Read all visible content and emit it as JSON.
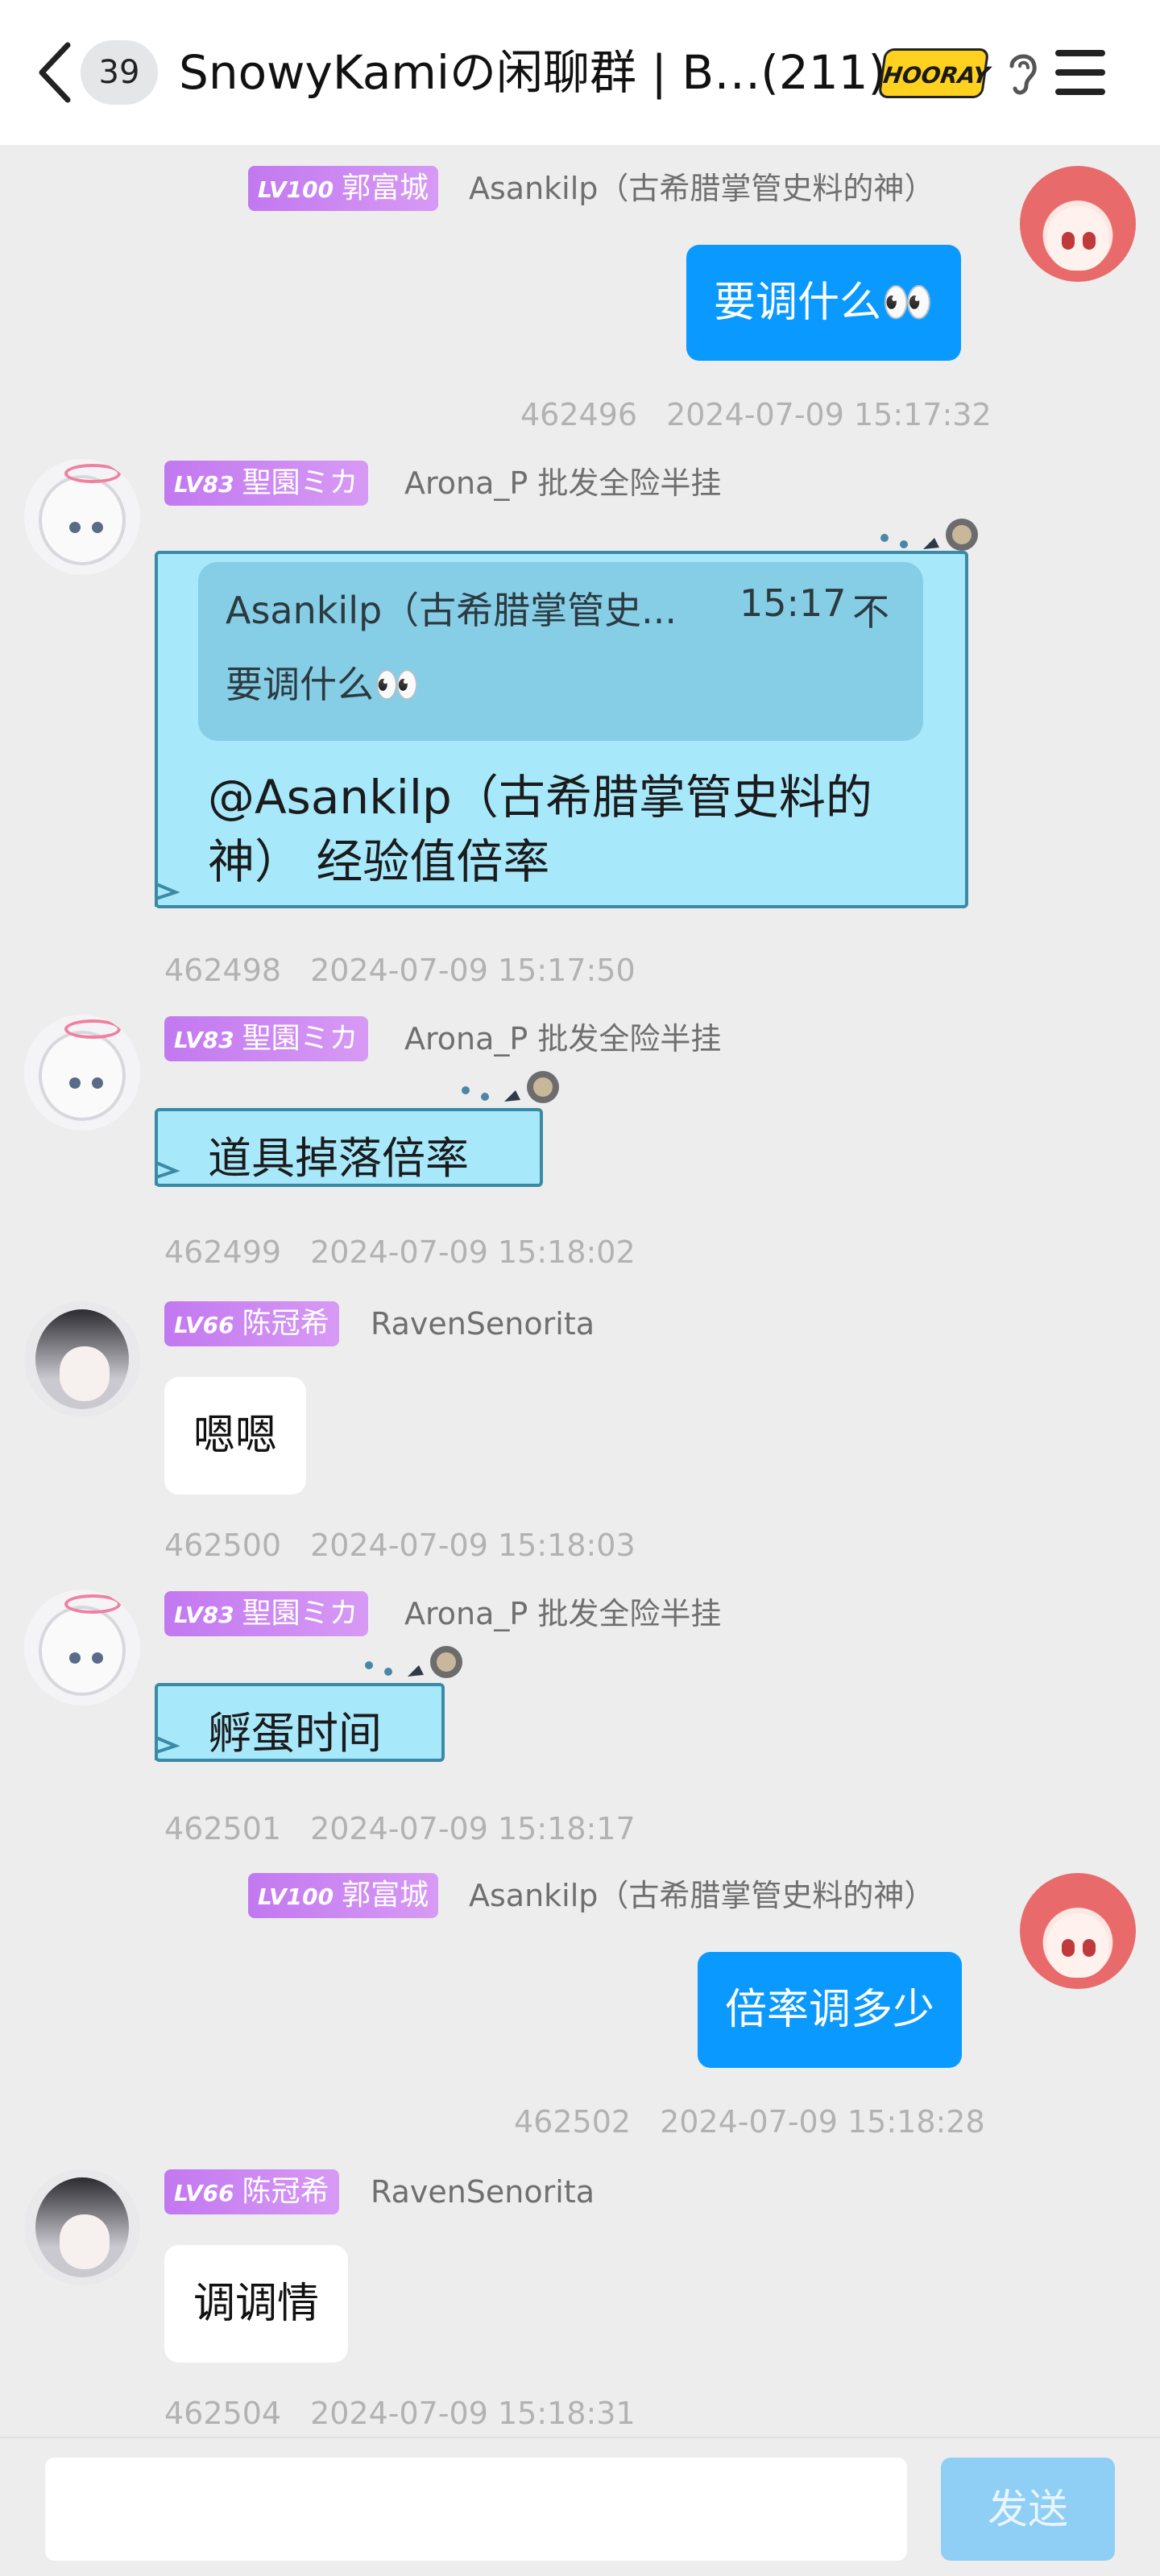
{
  "header": {
    "unread_count": "39",
    "title": "SnowyKamiの闲聊群 | B…(211)",
    "sticker_text": "HOORAY"
  },
  "messages": [
    {
      "side": "right",
      "badge_lv": "LV100",
      "badge_name": "郭富城",
      "username": "Asankilp（古希腊掌管史料的神）",
      "text": "要调什么👀",
      "msg_id": "462496",
      "time": "2024-07-09 15:17:32"
    },
    {
      "side": "left",
      "badge_lv": "LV83",
      "badge_name": "聖園ミカ",
      "username": "Arona_P 批发全险半挂",
      "quote_author": "Asankilp（古希腊掌管史...",
      "quote_time": "15:17",
      "quote_icon": "不",
      "quote_text": "要调什么👀",
      "text": "@Asankilp（古希腊掌管史料的神） 经验值倍率",
      "msg_id": "462498",
      "time": "2024-07-09 15:17:50"
    },
    {
      "side": "left",
      "badge_lv": "LV83",
      "badge_name": "聖園ミカ",
      "username": "Arona_P 批发全险半挂",
      "text": "道具掉落倍率",
      "msg_id": "462499",
      "time": "2024-07-09 15:18:02"
    },
    {
      "side": "left",
      "badge_lv": "LV66",
      "badge_name": "陈冠希",
      "username": "RavenSenorita",
      "text": "嗯嗯",
      "msg_id": "462500",
      "time": "2024-07-09 15:18:03"
    },
    {
      "side": "left",
      "badge_lv": "LV83",
      "badge_name": "聖園ミカ",
      "username": "Arona_P 批发全险半挂",
      "text": "孵蛋时间",
      "msg_id": "462501",
      "time": "2024-07-09 15:18:17"
    },
    {
      "side": "right",
      "badge_lv": "LV100",
      "badge_name": "郭富城",
      "username": "Asankilp（古希腊掌管史料的神）",
      "text": "倍率调多少",
      "msg_id": "462502",
      "time": "2024-07-09 15:18:28"
    },
    {
      "side": "left",
      "badge_lv": "LV66",
      "badge_name": "陈冠希",
      "username": "RavenSenorita",
      "text": "调调情",
      "msg_id": "462504",
      "time": "2024-07-09 15:18:31"
    }
  ],
  "input": {
    "placeholder": "",
    "send_label": "发送"
  },
  "colors": {
    "accent_blue": "#0a99ff",
    "cyan_bubble": "#a7e8fb",
    "badge_purple": "#c278f0",
    "send_disabled": "#8fcef5"
  }
}
